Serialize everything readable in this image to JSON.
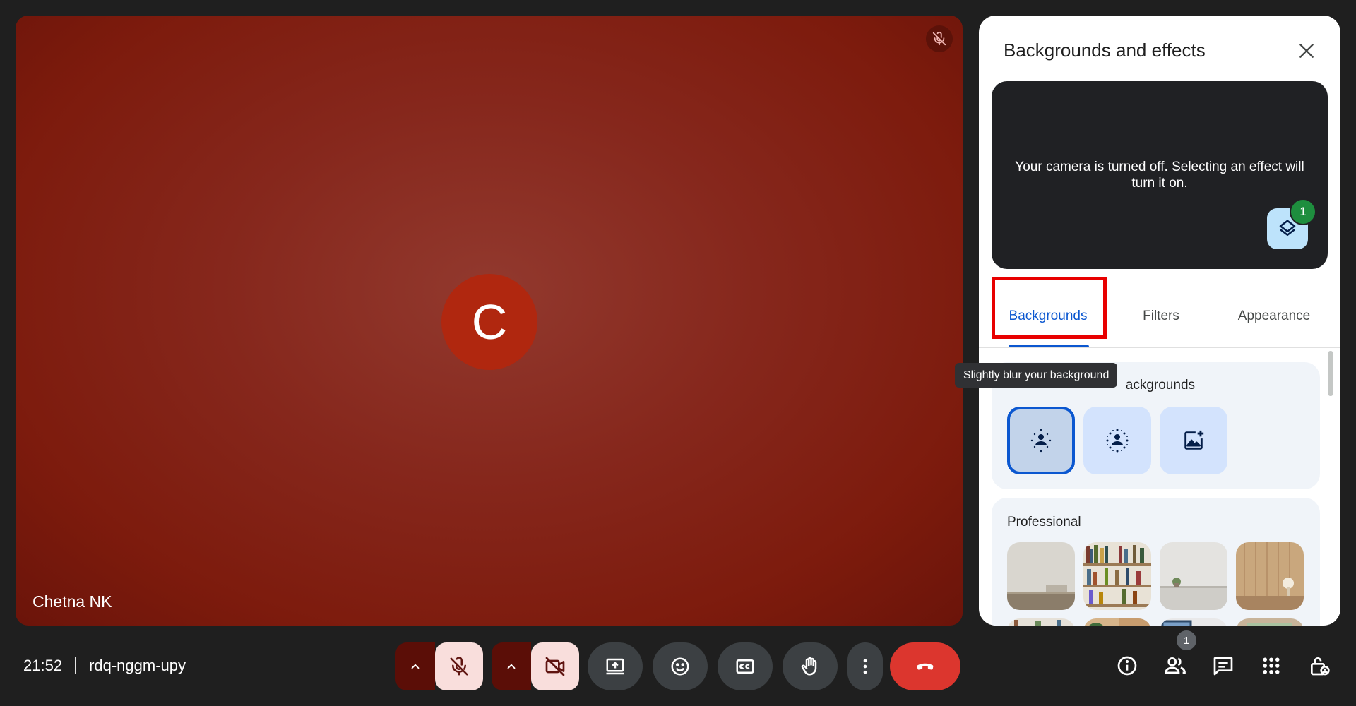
{
  "tile": {
    "participant_name": "Chetna NK",
    "avatar_letter": "C",
    "mic_status_icon": "mic-off-icon",
    "background_color": "#8b2a1e"
  },
  "panel": {
    "title": "Backgrounds and effects",
    "close_icon": "close-icon",
    "preview_message": "Your camera is turned off. Selecting an effect will turn it on.",
    "effects_badge_count": "1",
    "tabs": [
      {
        "label": "Backgrounds",
        "active": true
      },
      {
        "label": "Filters",
        "active": false
      },
      {
        "label": "Appearance",
        "active": false
      }
    ],
    "sections": {
      "blur_heading": "Blur and personal backgrounds",
      "blur_heading_visible": "ackgrounds",
      "professional_heading": "Professional"
    },
    "blur_options": [
      {
        "icon": "slight-blur-icon",
        "selected": true
      },
      {
        "icon": "blur-icon",
        "selected": false
      },
      {
        "icon": "add-image-icon",
        "selected": false
      }
    ],
    "tooltip": "Slightly blur your background"
  },
  "bottom_bar": {
    "time": "21:52",
    "meeting_code": "rdq-nggm-upy",
    "controls": [
      "chevron-up-icon",
      "mic-off-icon",
      "chevron-up-icon",
      "camera-off-icon",
      "present-screen-icon",
      "emoji-icon",
      "captions-icon",
      "raise-hand-icon",
      "more-options-icon",
      "end-call-icon"
    ],
    "right_icons": [
      "info-icon",
      "people-icon",
      "chat-icon",
      "activities-icon",
      "host-controls-icon"
    ],
    "people_count": "1"
  },
  "colors": {
    "accent": "#0b57d0",
    "end_call": "#dc362e",
    "badge_green": "#1e8e3e",
    "highlight_red": "#e80000"
  }
}
